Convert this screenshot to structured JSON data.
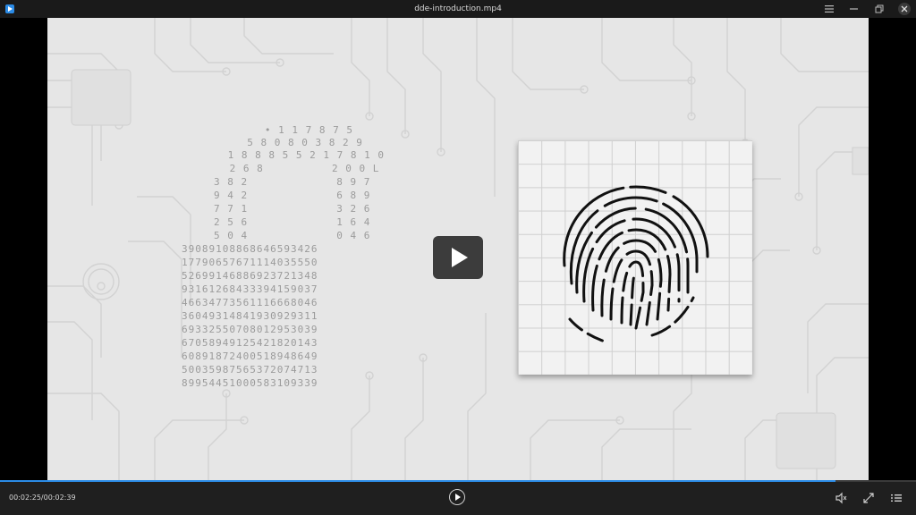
{
  "window": {
    "title": "dde-introduction.mp4",
    "icons": [
      "app-logo-icon",
      "menu-icon",
      "minimize-icon",
      "restore-icon",
      "close-icon"
    ]
  },
  "player": {
    "current_time": "00:02:25",
    "total_time": "00:02:39",
    "time_display": "00:02:25/00:02:39",
    "progress_fraction": 0.912,
    "accent_color": "#2b8be6"
  },
  "video": {
    "lock_digits": [
      "   • 1 1 7 8 7 5   ",
      "  5 8 0 8 0 3 8 2 9 ",
      " 1 8 8 8 5 5 2 1 7 8 1 0",
      " 2 6 8          2 0 0 L",
      "3 8 2             8 9 7",
      "9 4 2             6 8 9",
      "7 7 1             3 2 6",
      "2 5 6             1 6 4",
      "5 0 4             0 4 6",
      "39089108868646593426",
      "17790657671114035550",
      "52699146886923721348",
      "93161268433394159037",
      "46634773561116668046",
      "36049314841930929311",
      "69332550708012953039",
      "67058949125421820143",
      "60891872400518948649",
      "50035987565372074713",
      "89954451000583109339"
    ]
  },
  "controls": {
    "play_icon": "play-icon",
    "volume_icon": "volume-icon",
    "fullscreen_icon": "fullscreen-icon",
    "playlist_icon": "playlist-icon"
  }
}
